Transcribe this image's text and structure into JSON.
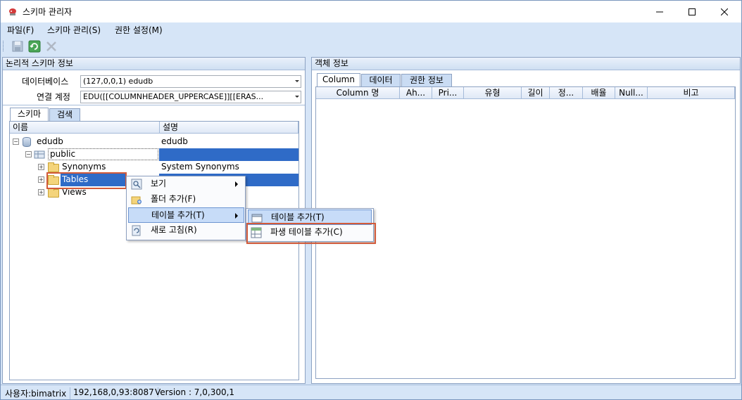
{
  "window": {
    "title": "스키마 관리자"
  },
  "menu": [
    "파일(F)",
    "스키마 관리(S)",
    "권한 설정(M)"
  ],
  "left_panel": {
    "title": "논리적 스키마 정보",
    "database_label": "데이터베이스",
    "database_value": "(127,0,0,1) edudb",
    "account_label": "연결 계정",
    "account_value": "EDU([[COLUMNHEADER_UPPERCASE]][[ERAS...",
    "tabs": [
      "스키마",
      "검색"
    ],
    "columns": [
      "이름",
      "설명"
    ],
    "tree": [
      {
        "name": "edudb",
        "desc": "edudb"
      },
      {
        "name": "public",
        "desc": ""
      },
      {
        "name": "Synonyms",
        "desc": "System Synonyms"
      },
      {
        "name": "Tables",
        "desc": ""
      },
      {
        "name": "Views",
        "desc": ""
      }
    ]
  },
  "right_panel": {
    "title": "객체 정보",
    "tabs": [
      "Column",
      "데이터",
      "권한 정보"
    ],
    "columns": [
      "Column 명",
      "Ah...",
      "Pri...",
      "유형",
      "길이",
      "정...",
      "배율",
      "Null...",
      "비고"
    ]
  },
  "context_menu": {
    "items": [
      "보기",
      "폴더 추가(F)",
      "테이블 추가(T)",
      "새로 고침(R)"
    ]
  },
  "submenu": {
    "items": [
      "테이블 추가(T)",
      "파생 테이블 추가(C)"
    ]
  },
  "status": {
    "user": "사용자:bimatrix",
    "server": "192,168,0,93:8087",
    "version": "Version : 7,0,300,1"
  }
}
